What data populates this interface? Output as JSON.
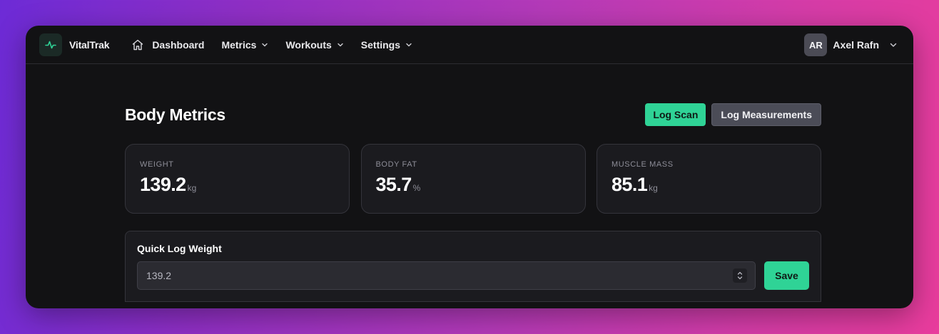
{
  "app": {
    "name": "VitalTrak",
    "accent_color": "#2fd396",
    "logo_icon": "activity-pulse-icon"
  },
  "nav": {
    "items": [
      {
        "label": "Dashboard",
        "icon": "home-icon",
        "has_dropdown": false
      },
      {
        "label": "Metrics",
        "has_dropdown": true
      },
      {
        "label": "Workouts",
        "has_dropdown": true
      },
      {
        "label": "Settings",
        "has_dropdown": true
      }
    ]
  },
  "user": {
    "initials": "AR",
    "name": "Axel Rafn"
  },
  "page": {
    "title": "Body Metrics",
    "actions": {
      "log_scan": "Log Scan",
      "log_measurements": "Log Measurements"
    }
  },
  "metrics": [
    {
      "label": "Weight",
      "value": "139.2",
      "unit": "kg"
    },
    {
      "label": "Body Fat",
      "value": "35.7",
      "unit": "%"
    },
    {
      "label": "Muscle Mass",
      "value": "85.1",
      "unit": "kg"
    }
  ],
  "quick_log": {
    "title": "Quick Log Weight",
    "value": "139.2",
    "save_label": "Save"
  }
}
